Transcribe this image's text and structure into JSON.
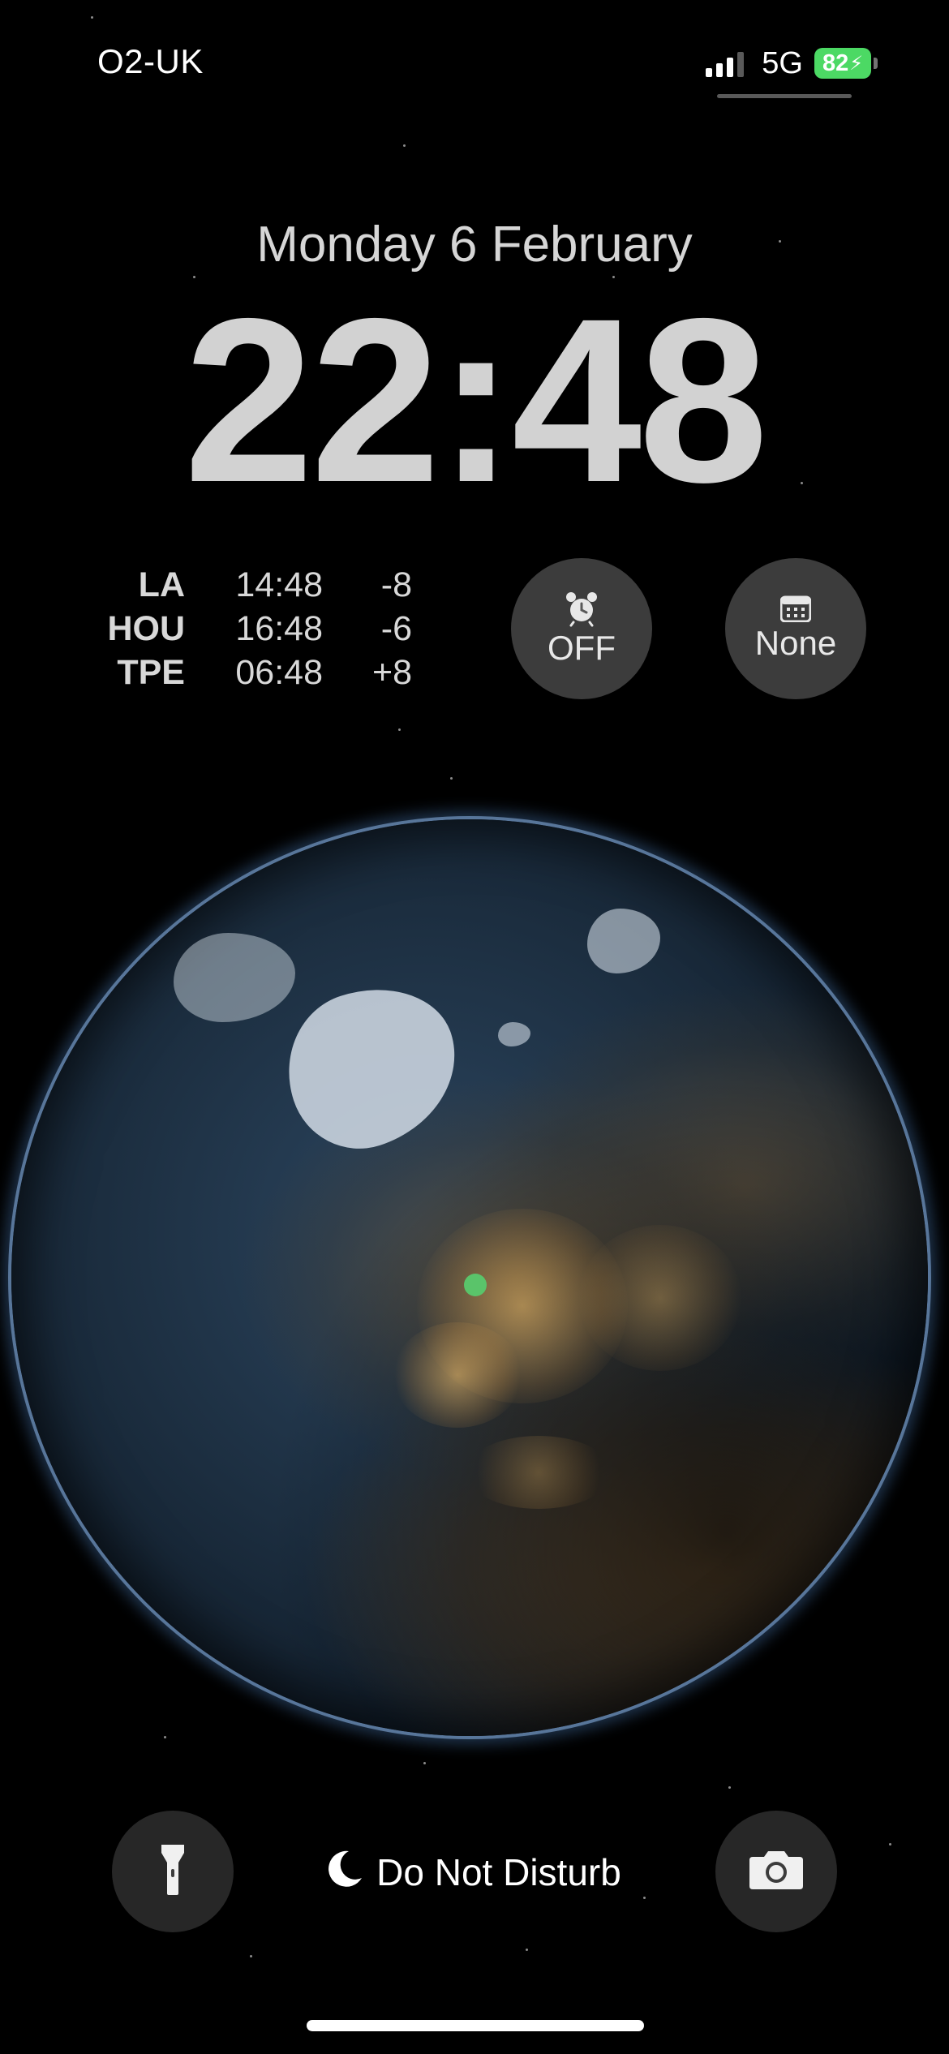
{
  "status_bar": {
    "carrier": "O2-UK",
    "network": "5G",
    "battery_percent": "82",
    "signal_bars_filled": 3,
    "signal_bars_total": 4,
    "battery_charging": true
  },
  "lock_screen": {
    "date": "Monday 6 February",
    "time": "22:48"
  },
  "world_clock": {
    "rows": [
      {
        "city": "LA",
        "time": "14:48",
        "offset": "-8"
      },
      {
        "city": "HOU",
        "time": "16:48",
        "offset": "-6"
      },
      {
        "city": "TPE",
        "time": "06:48",
        "offset": "+8"
      }
    ]
  },
  "widgets": {
    "alarm": {
      "label": "OFF",
      "icon": "alarm-clock-icon"
    },
    "calendar": {
      "label": "None",
      "icon": "calendar-icon"
    }
  },
  "bottom": {
    "focus_label": "Do Not Disturb",
    "focus_icon": "moon-icon",
    "flashlight_icon": "flashlight-icon",
    "camera_icon": "camera-icon"
  },
  "colors": {
    "battery": "#4cd964",
    "location_dot": "#5ac46a",
    "background": "#000000"
  }
}
